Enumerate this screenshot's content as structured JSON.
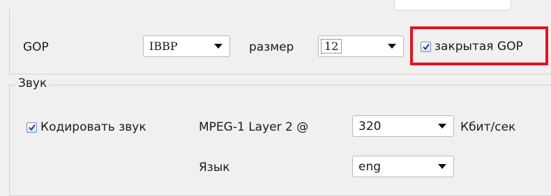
{
  "accent_color": "#e0141f",
  "gop": {
    "label": "GOP",
    "type_value": "IBBP",
    "size_label": "размер",
    "size_value": "12",
    "closed_gop_label": "закрытая GOP",
    "closed_gop_checked": true
  },
  "sound": {
    "group_title": "Звук",
    "encode_label": "Кодировать звук",
    "encode_checked": true,
    "codec_label": "MPEG-1 Layer 2 @",
    "bitrate_value": "320",
    "bitrate_unit": "Кбит/сек",
    "language_label": "Язык",
    "language_value": "eng"
  },
  "icons": {
    "dropdown": "chevron-down-icon",
    "checkbox_check": "checkmark-icon"
  }
}
